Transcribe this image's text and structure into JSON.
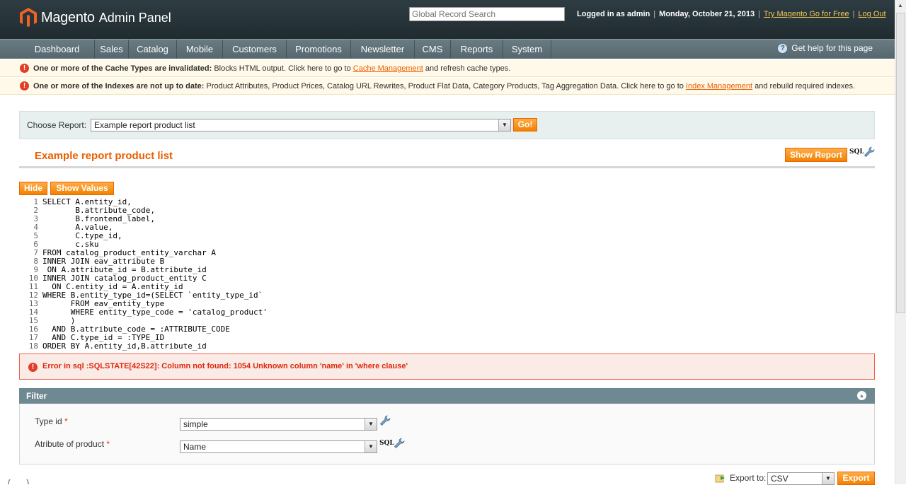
{
  "header": {
    "brand": "Magento",
    "brand_sub": "Admin Panel",
    "search_placeholder": "Global Record Search",
    "logged_in": "Logged in as admin",
    "date": "Monday, October 21, 2013",
    "try_link": "Try Magento Go for Free",
    "logout": "Log Out"
  },
  "nav": {
    "items": [
      "Dashboard",
      "Sales",
      "Catalog",
      "Mobile",
      "Customers",
      "Promotions",
      "Newsletter",
      "CMS",
      "Reports",
      "System"
    ],
    "help": "Get help for this page"
  },
  "notices": [
    {
      "bold": "One or more of the Cache Types are invalidated:",
      "text": " Blocks HTML output. Click here to go to ",
      "link": "Cache Management",
      "tail": " and refresh cache types."
    },
    {
      "bold": "One or more of the Indexes are not up to date:",
      "text": " Product Attributes, Product Prices, Catalog URL Rewrites, Product Flat Data, Category Products, Tag Aggregation Data. Click here to go to ",
      "link": "Index Management",
      "tail": " and rebuild required indexes."
    }
  ],
  "report_chooser": {
    "label": "Choose Report:",
    "selected": "Example report product list",
    "go": "Go!"
  },
  "page": {
    "title": "Example report product list",
    "show_report": "Show Report",
    "sql_mark": "SQL",
    "hide": "Hide",
    "show_values": "Show Values"
  },
  "sql_lines": [
    "SELECT A.entity_id,",
    "       B.attribute_code,",
    "       B.frontend_label,",
    "       A.value,",
    "       C.type_id,",
    "       c.sku",
    "FROM catalog_product_entity_varchar A",
    "INNER JOIN eav_attribute B",
    " ON A.attribute_id = B.attribute_id",
    "INNER JOIN catalog_product_entity C",
    "  ON C.entity_id = A.entity_id",
    "WHERE B.entity_type_id=(SELECT `entity_type_id`",
    "      FROM eav_entity_type",
    "      WHERE entity_type_code = 'catalog_product'",
    "      )",
    "  AND B.attribute_code = :ATTRIBUTE_CODE",
    "  AND C.type_id = :TYPE_ID",
    "ORDER BY A.entity_id,B.attribute_id"
  ],
  "error": {
    "message": "Error in sql :SQLSTATE[42S22]: Column not found: 1054 Unknown column 'name' in 'where clause'"
  },
  "filter": {
    "title": "Filter",
    "type_id_label": "Type id",
    "type_id_value": "simple",
    "attr_label": "Atribute of product",
    "attr_value": "Name",
    "sql_mark": "SQL",
    "required_mark": "*"
  },
  "export": {
    "label": "Export to:",
    "format": "CSV",
    "button": "Export"
  }
}
